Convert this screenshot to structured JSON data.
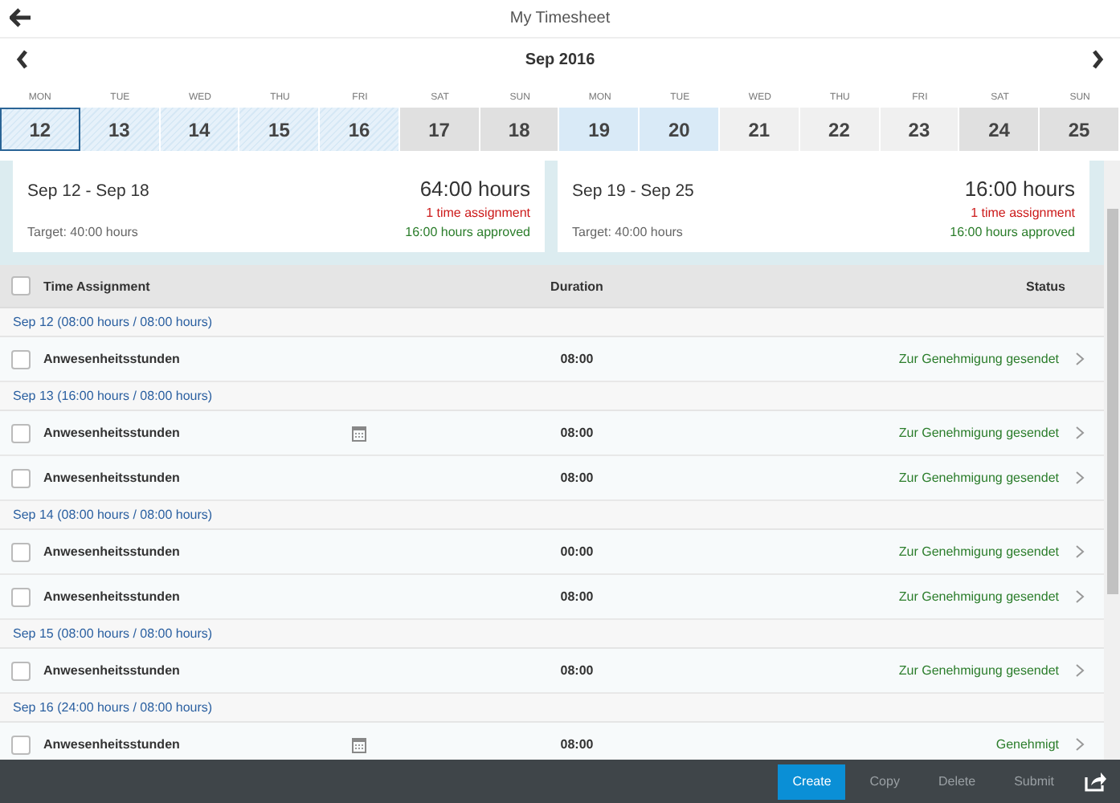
{
  "header": {
    "title": "My Timesheet"
  },
  "calendar": {
    "month": "Sep 2016",
    "days": [
      {
        "weekday": "MON",
        "date": "12",
        "kind": "submitted",
        "selected": true
      },
      {
        "weekday": "TUE",
        "date": "13",
        "kind": "submitted",
        "selected": false
      },
      {
        "weekday": "WED",
        "date": "14",
        "kind": "submitted",
        "selected": false
      },
      {
        "weekday": "THU",
        "date": "15",
        "kind": "submitted",
        "selected": false
      },
      {
        "weekday": "FRI",
        "date": "16",
        "kind": "submitted",
        "selected": false
      },
      {
        "weekday": "SAT",
        "date": "17",
        "kind": "weekend",
        "selected": false
      },
      {
        "weekday": "SUN",
        "date": "18",
        "kind": "weekend",
        "selected": false
      },
      {
        "weekday": "MON",
        "date": "19",
        "kind": "booked",
        "selected": false
      },
      {
        "weekday": "TUE",
        "date": "20",
        "kind": "booked",
        "selected": false
      },
      {
        "weekday": "WED",
        "date": "21",
        "kind": "open",
        "selected": false
      },
      {
        "weekday": "THU",
        "date": "22",
        "kind": "open",
        "selected": false
      },
      {
        "weekday": "FRI",
        "date": "23",
        "kind": "open",
        "selected": false
      },
      {
        "weekday": "SAT",
        "date": "24",
        "kind": "weekend",
        "selected": false
      },
      {
        "weekday": "SUN",
        "date": "25",
        "kind": "weekend",
        "selected": false
      }
    ]
  },
  "weeks": [
    {
      "range": "Sep 12 - Sep 18",
      "hours": "64:00 hours",
      "assignments": "1 time assignment",
      "target": "Target: 40:00 hours",
      "approved": "16:00 hours approved"
    },
    {
      "range": "Sep 19 - Sep 25",
      "hours": "16:00 hours",
      "assignments": "1 time assignment",
      "target": "Target: 40:00 hours",
      "approved": "16:00 hours approved"
    }
  ],
  "table": {
    "select_all": false,
    "columns": [
      "Time Assignment",
      "Duration",
      "Status"
    ],
    "groups": [
      {
        "title": "Sep 12 (08:00 hours / 08:00 hours)",
        "rows": [
          {
            "name": "Anwesenheitsstunden",
            "note": false,
            "duration": "08:00",
            "status": "Zur Genehmigung gesendet",
            "checked": false
          }
        ]
      },
      {
        "title": "Sep 13 (16:00 hours / 08:00 hours)",
        "rows": [
          {
            "name": "Anwesenheitsstunden",
            "note": true,
            "duration": "08:00",
            "status": "Zur Genehmigung gesendet",
            "checked": false
          },
          {
            "name": "Anwesenheitsstunden",
            "note": false,
            "duration": "08:00",
            "status": "Zur Genehmigung gesendet",
            "checked": false
          }
        ]
      },
      {
        "title": "Sep 14 (08:00 hours / 08:00 hours)",
        "rows": [
          {
            "name": "Anwesenheitsstunden",
            "note": false,
            "duration": "00:00",
            "status": "Zur Genehmigung gesendet",
            "checked": false
          },
          {
            "name": "Anwesenheitsstunden",
            "note": false,
            "duration": "08:00",
            "status": "Zur Genehmigung gesendet",
            "checked": false
          }
        ]
      },
      {
        "title": "Sep 15 (08:00 hours / 08:00 hours)",
        "rows": [
          {
            "name": "Anwesenheitsstunden",
            "note": false,
            "duration": "08:00",
            "status": "Zur Genehmigung gesendet",
            "checked": false
          }
        ]
      },
      {
        "title": "Sep 16 (24:00 hours / 08:00 hours)",
        "rows": [
          {
            "name": "Anwesenheitsstunden",
            "note": true,
            "duration": "08:00",
            "status": "Genehmigt",
            "checked": false
          }
        ]
      }
    ]
  },
  "footer": {
    "buttons": [
      {
        "label": "Create",
        "kind": "primary"
      },
      {
        "label": "Copy",
        "kind": "plain"
      },
      {
        "label": "Delete",
        "kind": "plain"
      },
      {
        "label": "Submit",
        "kind": "plain"
      }
    ]
  }
}
